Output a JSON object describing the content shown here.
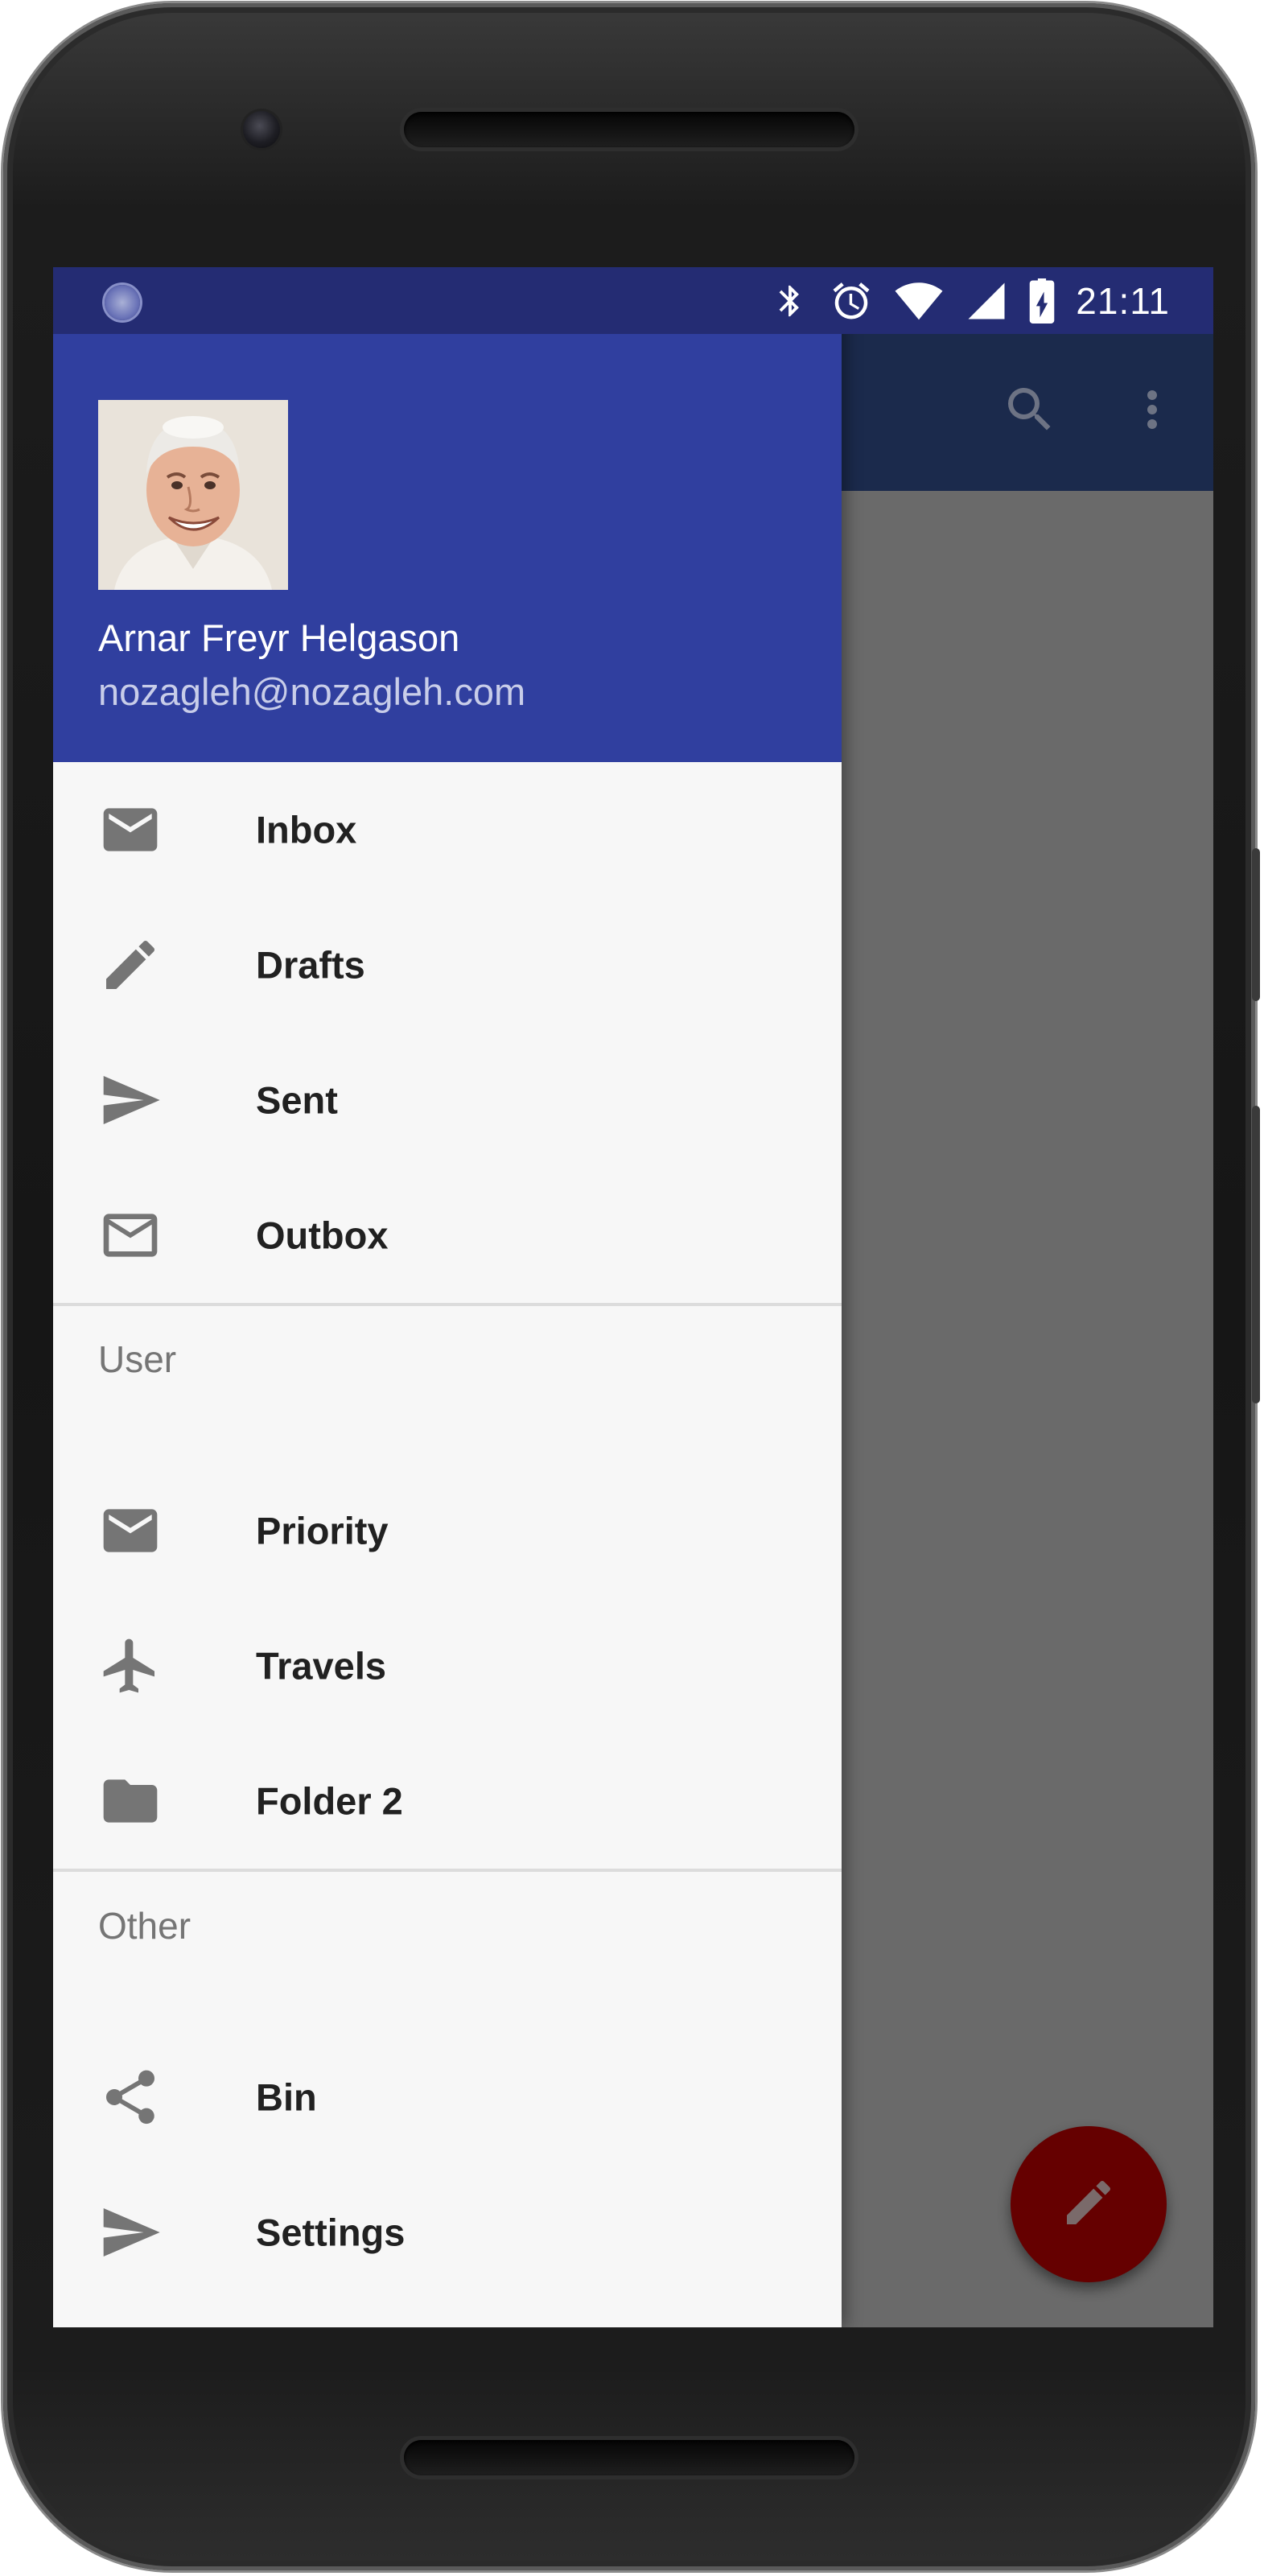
{
  "status_bar": {
    "time": "21:11",
    "icons": [
      "notification-icon",
      "bluetooth-icon",
      "alarm-icon",
      "wifi-icon",
      "cell-signal-icon",
      "battery-charging-icon"
    ]
  },
  "app_bar": {
    "actions": [
      "search-icon",
      "more-vert-icon"
    ]
  },
  "drawer": {
    "header": {
      "name": "Arnar Freyr Helgason",
      "email": "nozagleh@nozagleh.com",
      "background": "#303f9f"
    },
    "main_items": [
      {
        "label": "Inbox",
        "icon": "mail-icon"
      },
      {
        "label": "Drafts",
        "icon": "pencil-icon"
      },
      {
        "label": "Sent",
        "icon": "send-icon"
      },
      {
        "label": "Outbox",
        "icon": "mail-outline-icon"
      }
    ],
    "sections": [
      {
        "title": "User",
        "items": [
          {
            "label": "Priority",
            "icon": "mail-icon"
          },
          {
            "label": "Travels",
            "icon": "airplane-icon"
          },
          {
            "label": "Folder 2",
            "icon": "folder-icon"
          }
        ]
      },
      {
        "title": "Other",
        "items": [
          {
            "label": "Bin",
            "icon": "share-icon"
          },
          {
            "label": "Settings",
            "icon": "send-icon"
          }
        ]
      }
    ]
  },
  "fab": {
    "icon": "pencil-icon",
    "color": "#650000"
  },
  "colors": {
    "status_bar": "#242c73",
    "app_bar": "#1b2a4c",
    "scrim": "#6a6a6a",
    "icon_gray": "#757575"
  }
}
